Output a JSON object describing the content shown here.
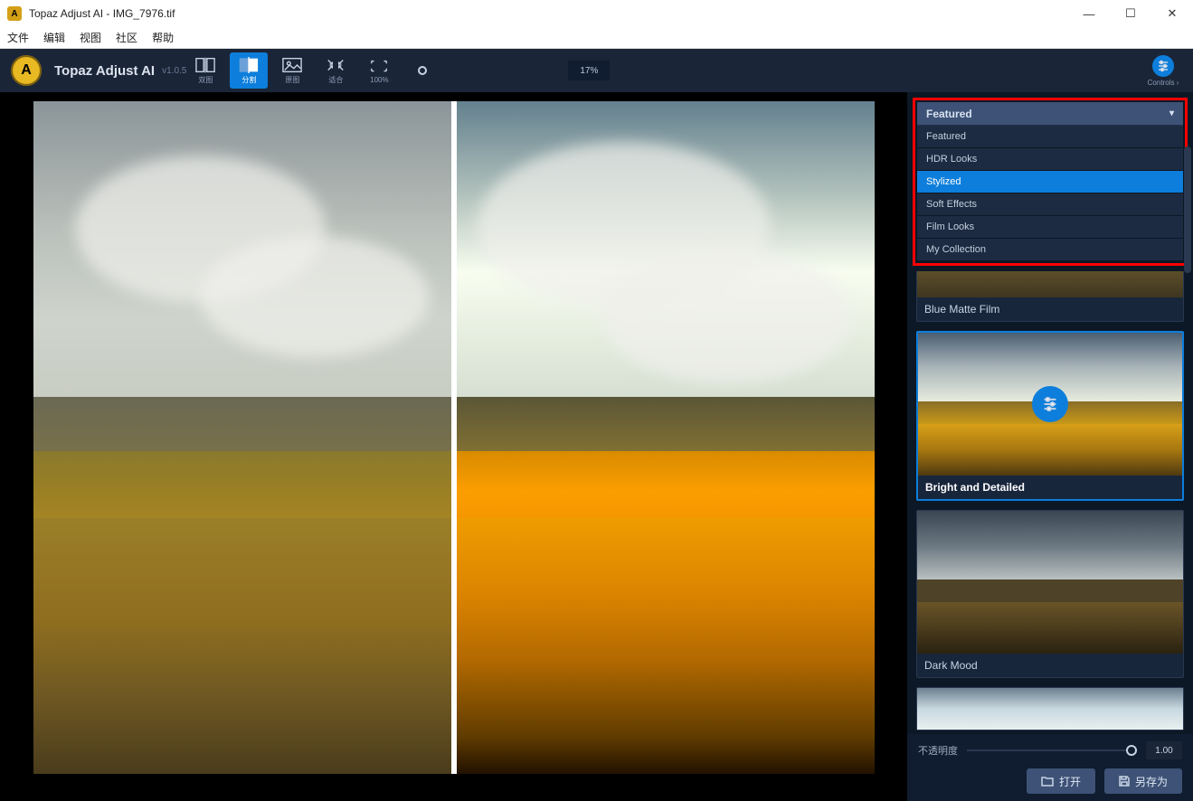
{
  "window": {
    "title": "Topaz Adjust AI - IMG_7976.tif"
  },
  "menu": {
    "file": "文件",
    "edit": "编辑",
    "view": "视图",
    "community": "社区",
    "help": "帮助"
  },
  "header": {
    "app_name": "Topaz Adjust AI",
    "version": "v1.0.5",
    "view_modes": {
      "dual": "双图",
      "split": "分割",
      "single": "原图",
      "fit": "适合",
      "hundred": "100%"
    },
    "zoom": "17%",
    "controls": "Controls"
  },
  "dropdown": {
    "selected": "Featured",
    "items": [
      "Featured",
      "HDR Looks",
      "Stylized",
      "Soft Effects",
      "Film Looks",
      "My Collection"
    ],
    "hovered_index": 2
  },
  "presets": [
    {
      "name": "Blue Matte Film",
      "selected": false
    },
    {
      "name": "Bright and Detailed",
      "selected": true
    },
    {
      "name": "Dark Mood",
      "selected": false
    }
  ],
  "opacity": {
    "label": "不透明度",
    "value": "1.00"
  },
  "actions": {
    "open": "打开",
    "save_as": "另存为"
  }
}
